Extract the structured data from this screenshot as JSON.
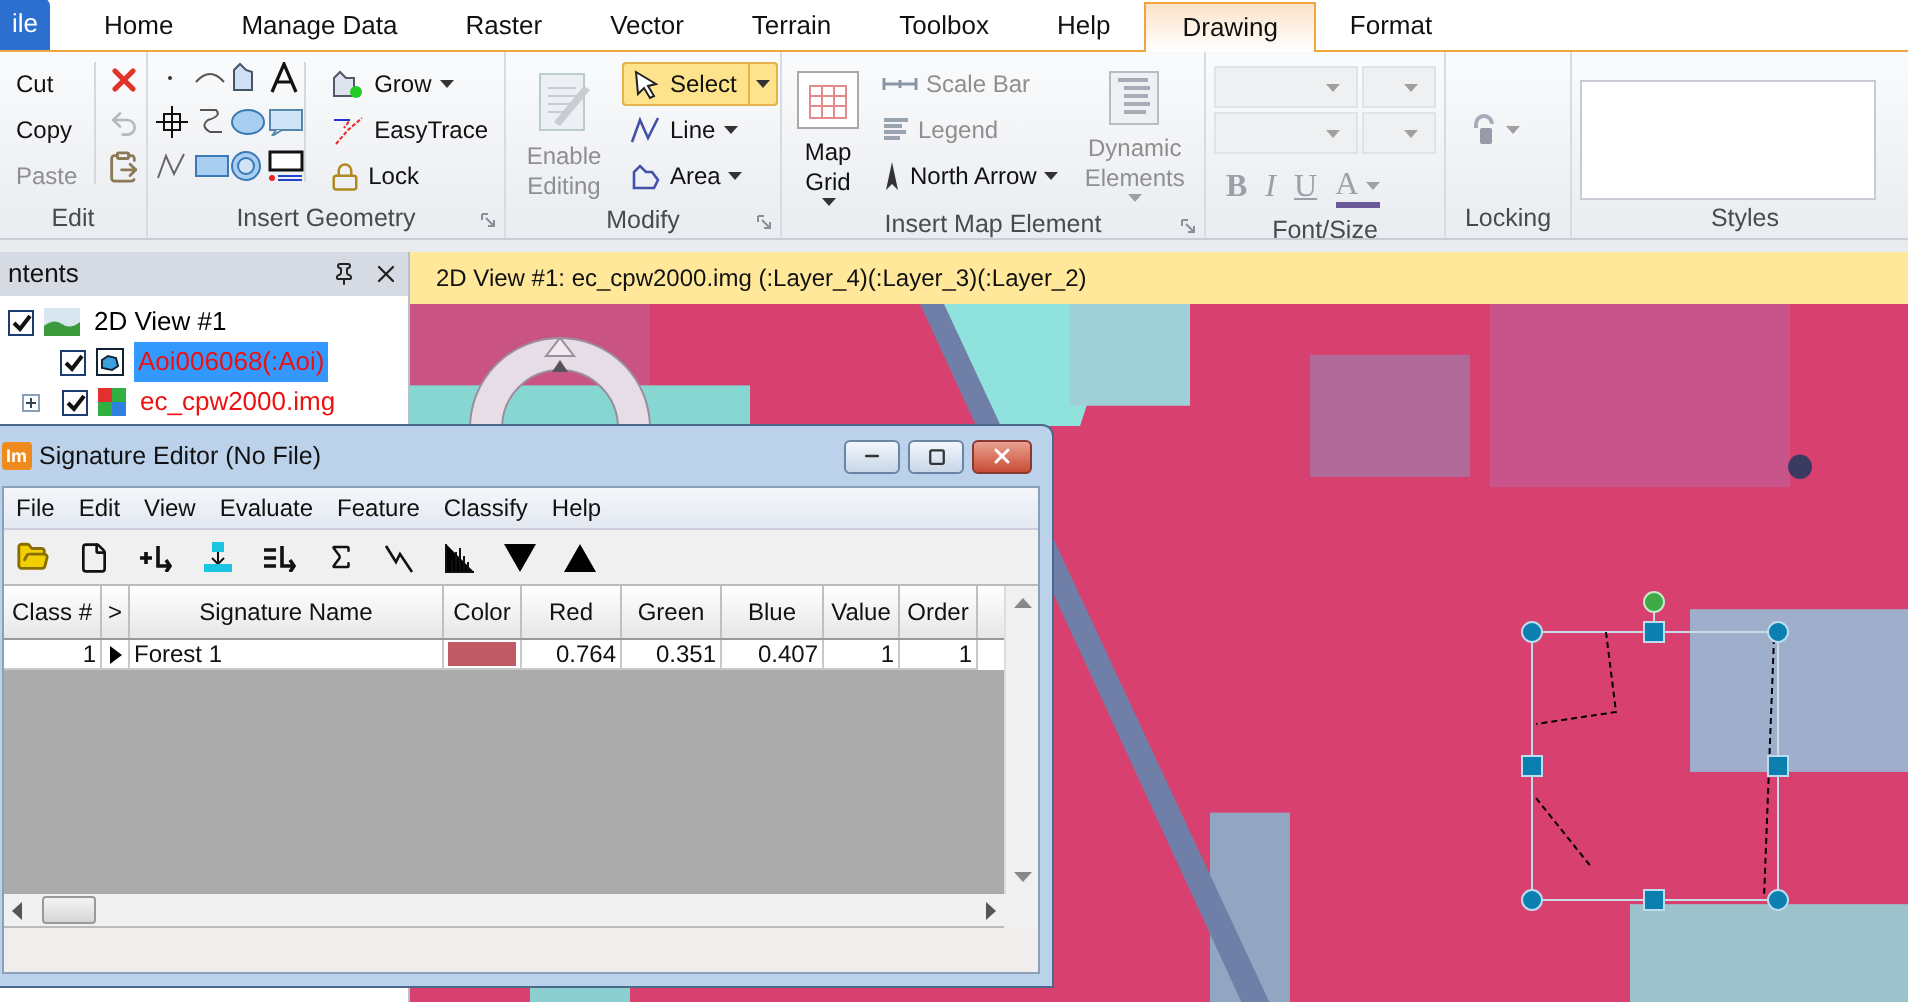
{
  "ribbon": {
    "tabs": [
      {
        "label": "ile",
        "kind": "file",
        "selected": false
      },
      {
        "label": "Home",
        "kind": "tab",
        "selected": false
      },
      {
        "label": "Manage Data",
        "kind": "tab",
        "selected": false
      },
      {
        "label": "Raster",
        "kind": "tab",
        "selected": false
      },
      {
        "label": "Vector",
        "kind": "tab",
        "selected": false
      },
      {
        "label": "Terrain",
        "kind": "tab",
        "selected": false
      },
      {
        "label": "Toolbox",
        "kind": "tab",
        "selected": false
      },
      {
        "label": "Help",
        "kind": "tab",
        "selected": false
      },
      {
        "label": "Drawing",
        "kind": "tab",
        "selected": true
      },
      {
        "label": "Format",
        "kind": "tab",
        "selected": false
      }
    ],
    "groups": [
      {
        "label": "Edit",
        "kind": "edit",
        "items": [
          {
            "label": "Cut",
            "kind": "small",
            "disabled": false
          },
          {
            "label": "Copy",
            "kind": "small",
            "disabled": false
          },
          {
            "label": "Paste",
            "kind": "small",
            "disabled": true
          }
        ]
      },
      {
        "label": "Insert Geometry",
        "kind": "geometry",
        "items": [
          {
            "label": "Grow",
            "kind": "small",
            "disabled": false,
            "dropdown": true
          },
          {
            "label": "EasyTrace",
            "kind": "small",
            "disabled": false
          },
          {
            "label": "Lock",
            "kind": "small",
            "disabled": false
          }
        ]
      },
      {
        "label": "Modify",
        "kind": "buttons",
        "items": [
          {
            "label": "Enable Editing",
            "kind": "large",
            "disabled": true
          },
          {
            "label": "Select",
            "kind": "small",
            "disabled": false,
            "selected": true,
            "dropdown": true
          },
          {
            "label": "Line",
            "kind": "small",
            "disabled": false,
            "selected": false,
            "dropdown": true
          },
          {
            "label": "Area",
            "kind": "small",
            "disabled": false,
            "selected": false,
            "dropdown": true
          }
        ]
      },
      {
        "label": "Insert Map Element",
        "kind": "buttons",
        "items": [
          {
            "label": "Map Grid",
            "kind": "large",
            "disabled": false,
            "dropdown": true
          },
          {
            "label": "Scale Bar",
            "kind": "small",
            "disabled": true
          },
          {
            "label": "Legend",
            "kind": "small",
            "disabled": true
          },
          {
            "label": "North Arrow",
            "kind": "small",
            "disabled": false,
            "dropdown": true
          },
          {
            "label": "Dynamic Elements",
            "kind": "large",
            "disabled": true,
            "dropdown": true
          }
        ]
      },
      {
        "label": "Font/Size",
        "kind": "font",
        "items": [
          {
            "label": "B",
            "disabled": true
          },
          {
            "label": "I",
            "disabled": true
          },
          {
            "label": "U",
            "disabled": true
          },
          {
            "label": "A",
            "disabled": true,
            "dropdown": true
          }
        ]
      },
      {
        "label": "Locking",
        "kind": "locking"
      },
      {
        "label": "Styles",
        "kind": "styles"
      }
    ]
  },
  "contents": {
    "title": "ntents",
    "tree": [
      {
        "label": "2D View #1",
        "kind": "view",
        "checked": true,
        "selected": false,
        "children": [
          {
            "label": "Aoi006068(:Aoi)",
            "kind": "aoi",
            "checked": true,
            "selected": true
          },
          {
            "label": "ec_cpw2000.img",
            "kind": "raster",
            "checked": true,
            "selected": false,
            "expanded": false
          }
        ]
      }
    ]
  },
  "view": {
    "title": "2D View #1: ec_cpw2000.img (:Layer_4)(:Layer_3)(:Layer_2)"
  },
  "signature_editor": {
    "title": "Signature Editor (No File)",
    "app_badge": "Im",
    "menu": [
      "File",
      "Edit",
      "View",
      "Evaluate",
      "Feature",
      "Classify",
      "Help"
    ],
    "columns": [
      "Class #",
      ">",
      "Signature Name",
      "Color",
      "Red",
      "Green",
      "Blue",
      "Value",
      "Order"
    ],
    "rows": [
      {
        "class": "1",
        "current": true,
        "name": "Forest 1",
        "color": "#c05a65",
        "red": "0.764",
        "green": "0.351",
        "blue": "0.407",
        "value": "1",
        "order": "1"
      }
    ]
  }
}
